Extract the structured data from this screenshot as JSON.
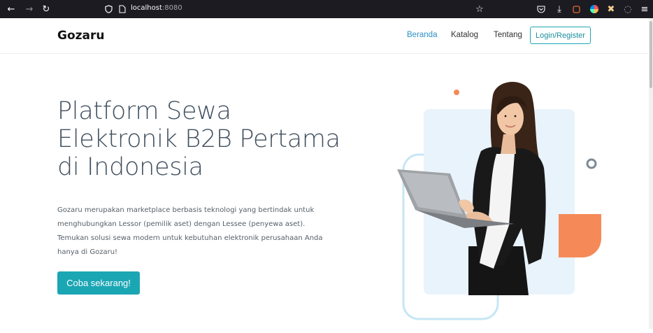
{
  "browser": {
    "url_host": "localhost",
    "url_port": ":8080"
  },
  "nav": {
    "logo": "Gozaru",
    "links": [
      "Beranda",
      "Katalog",
      "Tentang"
    ],
    "login_label": "Login/Register"
  },
  "hero": {
    "title_lines": [
      "Platform Sewa",
      "Elektronik B2B Pertama",
      "di Indonesia"
    ],
    "description": "Gozaru merupakan marketplace berbasis teknologi yang bertindak untuk menghubungkan Lessor (pemilik aset) dengan Lessee (penyewa aset). Temukan solusi sewa modern untuk kebutuhan elektronik perusahaan Anda hanya di Gozaru!",
    "cta_label": "Coba sekarang!"
  },
  "colors": {
    "accent": "#1ba6b4",
    "nav_active": "#2c8fc4",
    "orange": "#f58a58",
    "light_blue": "#e8f3fc",
    "outline_blue": "#c7e6f6"
  }
}
